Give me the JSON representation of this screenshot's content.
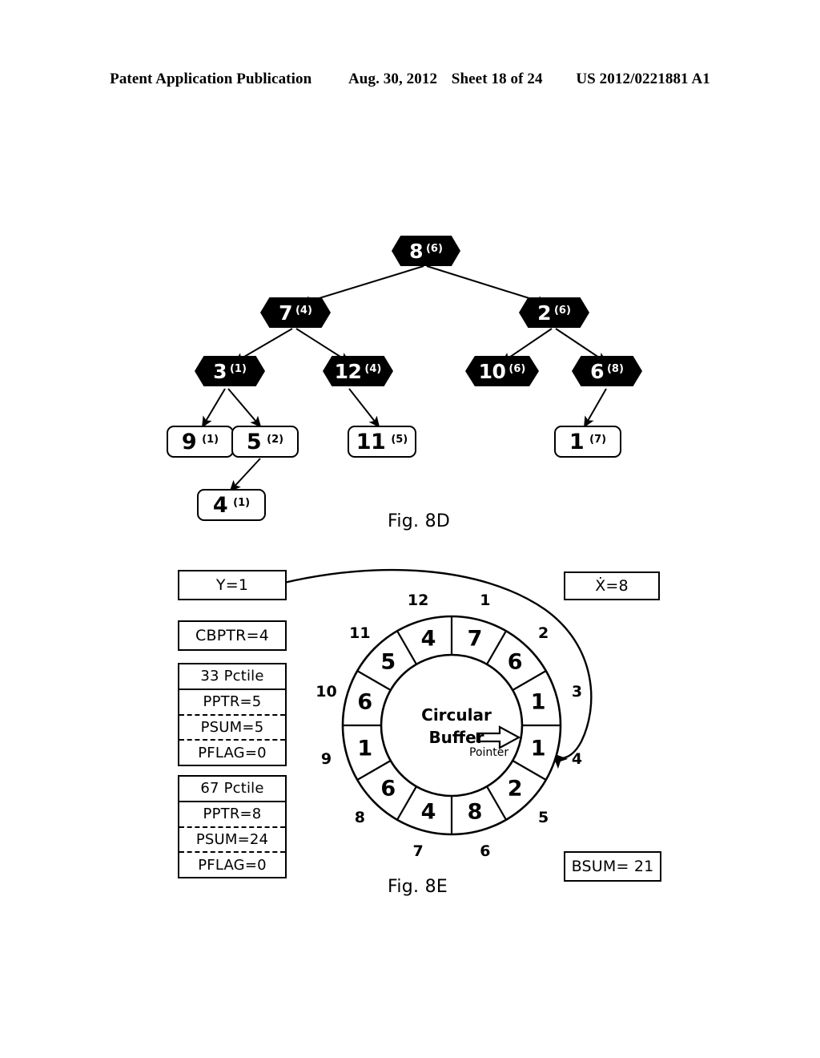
{
  "header": {
    "publication": "Patent Application Publication",
    "date": "Aug. 30, 2012",
    "sheet": "Sheet 18 of 24",
    "patent_number": "US 2012/0221881 A1"
  },
  "fig8d": {
    "caption": "Fig. 8D",
    "nodes": [
      {
        "id": "root",
        "key": "8",
        "count": "(6)"
      },
      {
        "id": "n7",
        "key": "7",
        "count": "(4)"
      },
      {
        "id": "n2",
        "key": "2",
        "count": "(6)"
      },
      {
        "id": "n3",
        "key": "3",
        "count": "(1)"
      },
      {
        "id": "n12",
        "key": "12",
        "count": "(4)"
      },
      {
        "id": "n10",
        "key": "10",
        "count": "(6)"
      },
      {
        "id": "n6",
        "key": "6",
        "count": "(8)"
      }
    ],
    "leaves": [
      {
        "id": "l9",
        "key": "9",
        "count": "(1)"
      },
      {
        "id": "l5",
        "key": "5",
        "count": "(2)"
      },
      {
        "id": "l11",
        "key": "11",
        "count": "(5)"
      },
      {
        "id": "l1",
        "key": "1",
        "count": "(7)"
      },
      {
        "id": "l4",
        "key": "4",
        "count": "(1)"
      }
    ]
  },
  "fig8e": {
    "caption": "Fig. 8E",
    "y_box": "Y=1",
    "cbptr_box": "CBPTR=4",
    "x_box": "Ẋ=8",
    "bsum_box": "BSUM= 21",
    "pctile_33": {
      "title": "33 Pctile",
      "pptr": "PPTR=5",
      "psum": "PSUM=5",
      "pflag": "PFLAG=0"
    },
    "pctile_67": {
      "title": "67 Pctile",
      "pptr": "PPTR=8",
      "psum": "PSUM=24",
      "pflag": "PFLAG=0"
    },
    "buffer": {
      "center_line1": "Circular",
      "center_line2": "Buffer",
      "pointer_label": "Pointer",
      "slot_count": 12,
      "indices": [
        "1",
        "2",
        "3",
        "4",
        "5",
        "6",
        "7",
        "8",
        "9",
        "10",
        "11",
        "12"
      ],
      "values": [
        "7",
        "6",
        "1",
        "1",
        "2",
        "8",
        "4",
        "6",
        "1",
        "6",
        "5",
        "4"
      ]
    }
  },
  "colors": {
    "ink": "#000000",
    "paper": "#ffffff"
  }
}
